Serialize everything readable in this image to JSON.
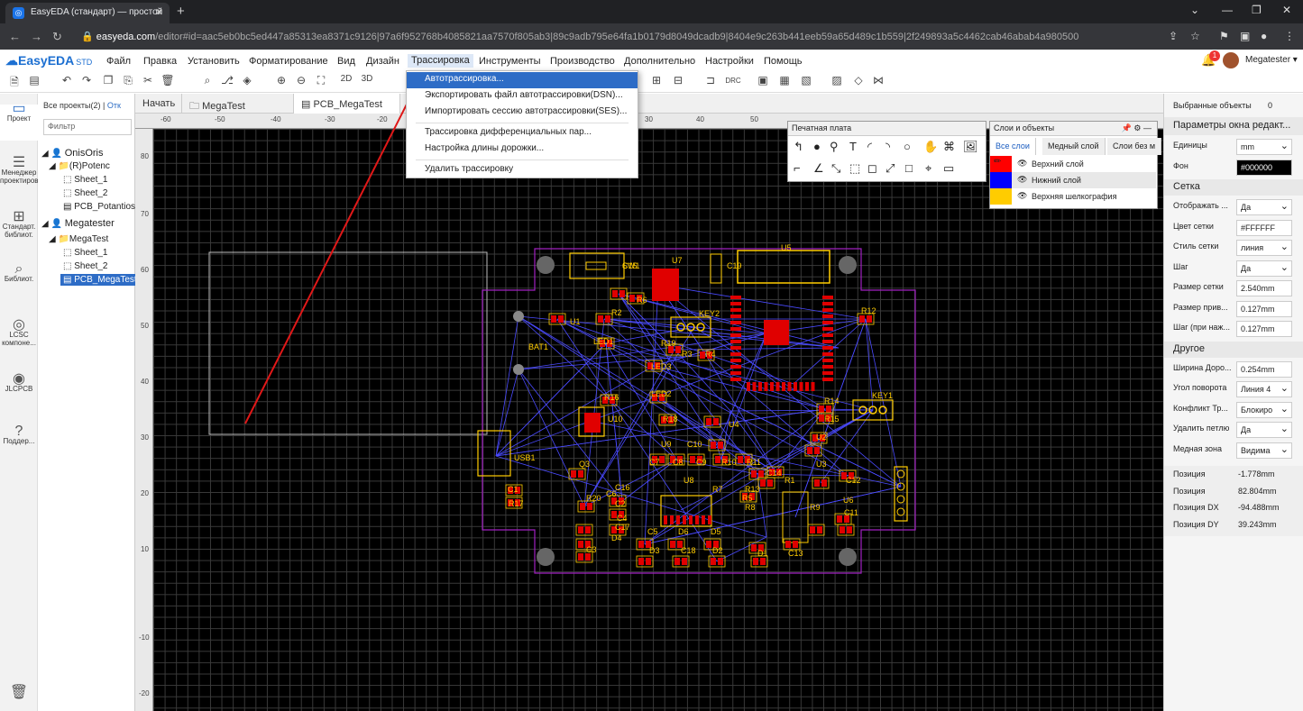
{
  "browser": {
    "tab_title": "EasyEDA (стандарт) — простой",
    "url_host": "easyeda.com",
    "url_rest": "/editor#id=aac5eb0bc5ed447a85313ea8371c9126|97a6f952768b4085821aa7570f805ab3|89c9adb795e64fa1b0179d8049dcadb9|8404e9c263b441eeb59a65d489c1b559|2f249893a5c4462cab46abab4a980500"
  },
  "app": {
    "logo": "EasyEDA",
    "logo_std": "STD",
    "menu": [
      "Файл",
      "Правка",
      "Установить",
      "Форматирование",
      "Вид",
      "Дизайн",
      "Трассировка",
      "Инструменты",
      "Производство",
      "Дополнительно",
      "Настройки",
      "Помощь"
    ],
    "active_menu": "Трассировка",
    "notifications": "1",
    "user": "Megatester ▾"
  },
  "dropdown": {
    "items": [
      "Автотрассировка...",
      "Экспортировать файл автотрассировки(DSN)...",
      "Импортировать сессию автотрассировки(SES)...",
      "Трассировка дифференциальных пар...",
      "Настройка длины дорожки...",
      "Удалить трассировку"
    ]
  },
  "rail": [
    {
      "label": "Проект",
      "icon": "folder-icon"
    },
    {
      "label": "Менеджер проектиров",
      "icon": "tree-icon"
    },
    {
      "label": "Стандарт. библиот.",
      "icon": "library-icon"
    },
    {
      "label": "Библиот.",
      "icon": "search-icon"
    },
    {
      "label": "LCSC компоне...",
      "icon": "lcsc-icon"
    },
    {
      "label": "JLCPCB",
      "icon": "jlc-icon"
    },
    {
      "label": "Поддер...",
      "icon": "help-icon"
    }
  ],
  "left_panel": {
    "projects_label": "Все проекты(2)",
    "sep": "|",
    "other_label": "Отк",
    "filter_placeholder": "Фильтр",
    "tree": [
      {
        "text": "OnisOris",
        "level": 0,
        "kind": "user"
      },
      {
        "text": "(R)Potenc",
        "level": 1,
        "kind": "folder"
      },
      {
        "text": "Sheet_1",
        "level": 2,
        "kind": "sheet"
      },
      {
        "text": "Sheet_2",
        "level": 2,
        "kind": "sheet"
      },
      {
        "text": "PCB_Potantiosta",
        "level": 2,
        "kind": "pcb"
      },
      {
        "text": "Megatester",
        "level": 0,
        "kind": "user"
      },
      {
        "text": "MegaTest",
        "level": 1,
        "kind": "folder"
      },
      {
        "text": "Sheet_1",
        "level": 2,
        "kind": "sheet"
      },
      {
        "text": "Sheet_2",
        "level": 2,
        "kind": "sheet"
      },
      {
        "text": "PCB_MegaTest",
        "level": 2,
        "kind": "pcb",
        "selected": true
      }
    ]
  },
  "doc_tabs": [
    "Начать",
    "MegaTest",
    "PCB_MegaTest"
  ],
  "ruler_top": [
    "-60",
    "-50",
    "-40",
    "-30",
    "-20",
    "30",
    "40",
    "50"
  ],
  "ruler_left": [
    "80",
    "70",
    "60",
    "50",
    "40",
    "30",
    "20",
    "10",
    "-10",
    "-20"
  ],
  "pcb_panel": {
    "title": "Печатная плата"
  },
  "layers_panel": {
    "title": "Слои и объекты",
    "tabs": [
      "Все слои",
      "Медный слой",
      "Слои без м"
    ],
    "layers": [
      {
        "name": "Верхний слой",
        "color": "#ff0000"
      },
      {
        "name": "Нижний слой",
        "color": "#0000ff"
      },
      {
        "name": "Верхняя шелкография",
        "color": "#ffcc00"
      }
    ]
  },
  "right_panel": {
    "selected_label": "Выбранные объекты",
    "selected_count": "0",
    "canvas_section": "Параметры окна редакт...",
    "props": [
      {
        "label": "Единицы",
        "value": "mm",
        "dropdown": true
      },
      {
        "label": "Фон",
        "value": "#000000",
        "dark": true
      },
      {
        "section": "Сетка"
      },
      {
        "label": "Отображать ...",
        "value": "Да",
        "dropdown": true
      },
      {
        "label": "Цвет сетки",
        "value": "#FFFFFF"
      },
      {
        "label": "Стиль сетки",
        "value": "линия",
        "dropdown": true
      },
      {
        "label": "Шаг",
        "value": "Да",
        "dropdown": true
      },
      {
        "label": "Размер сетки",
        "value": "2.540mm"
      },
      {
        "label": "Размер прив...",
        "value": "0.127mm"
      },
      {
        "label": "Шаг (при наж...",
        "value": "0.127mm"
      },
      {
        "section": "Другое"
      },
      {
        "label": "Ширина Доро...",
        "value": "0.254mm"
      },
      {
        "label": "Угол поворота",
        "value": "Линия 4",
        "dropdown": true
      },
      {
        "label": "Конфликт Тр...",
        "value": "Блокиро",
        "dropdown": true
      },
      {
        "label": "Удалить петлю",
        "value": "Да",
        "dropdown": true
      },
      {
        "label": "Медная зона",
        "value": "Видима",
        "dropdown": true
      }
    ],
    "position": [
      {
        "label": "Позиция",
        "value": "-1.778mm"
      },
      {
        "label": "Позиция",
        "value": "82.804mm"
      },
      {
        "label": "Позиция DX",
        "value": "-94.488mm"
      },
      {
        "label": "Позиция DY",
        "value": "39.243mm"
      }
    ]
  },
  "pcb_labels": [
    "SW1",
    "U7",
    "C19",
    "U5",
    "R6",
    "R2",
    "U1",
    "KEY2",
    "R12",
    "LED1",
    "R19",
    "BAT1",
    "R3",
    "R4",
    "LED3",
    "R16",
    "LED2",
    "KEY1",
    "R14",
    "U10",
    "R18",
    "U4",
    "R15",
    "U2",
    "U9",
    "C10",
    "USB1",
    "Q3",
    "C7",
    "C8",
    "C9",
    "R10",
    "R11",
    "U3",
    "C14",
    "C12",
    "U8",
    "R1",
    "R7",
    "R13",
    "R5",
    "R8",
    "R9",
    "U6",
    "C11",
    "C1",
    "R17",
    "R20",
    "C16",
    "C2",
    "C6",
    "C4",
    "C17",
    "C5",
    "D6",
    "D5",
    "D4",
    "C3",
    "C18",
    "D3",
    "D2",
    "D1",
    "C13",
    "C15"
  ]
}
